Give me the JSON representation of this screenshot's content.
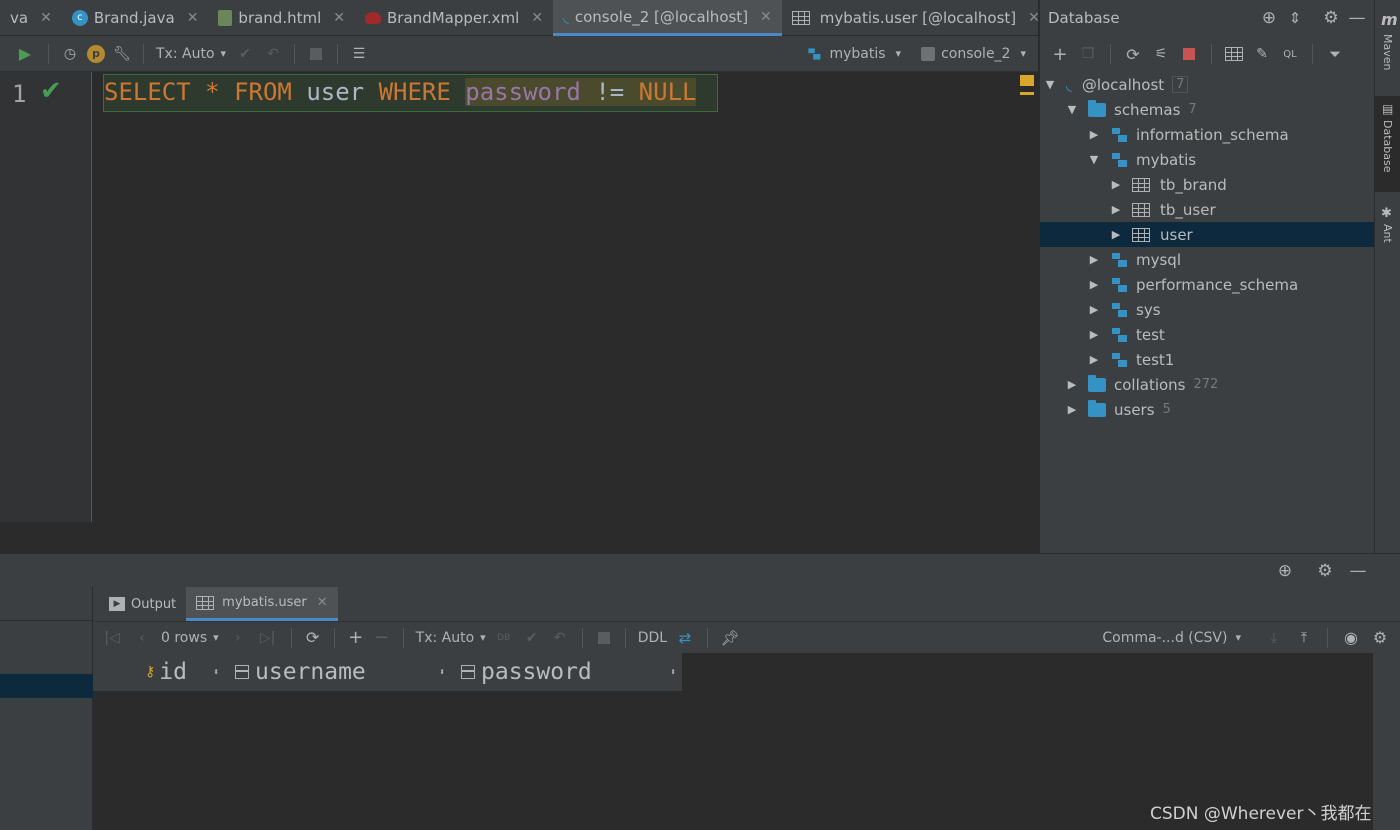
{
  "editor_tabs": [
    {
      "label": "va",
      "icon": "java-file-icon",
      "active": false
    },
    {
      "label": "Brand.java",
      "icon": "class-icon",
      "active": false
    },
    {
      "label": "brand.html",
      "icon": "html-icon",
      "active": false
    },
    {
      "label": "BrandMapper.xml",
      "icon": "xml-icon",
      "active": false
    },
    {
      "label": "console_2 [@localhost]",
      "icon": "console-icon",
      "active": true
    },
    {
      "label": "mybatis.user [@localhost]",
      "icon": "table-icon",
      "active": false
    }
  ],
  "editor_toolbar": {
    "tx_label": "Tx: Auto",
    "schema": "mybatis",
    "console": "console_2"
  },
  "editor": {
    "line_number": "1",
    "sql": {
      "kw_select": "SELECT",
      "star": "*",
      "kw_from": "FROM",
      "table": "user",
      "kw_where": "WHERE",
      "column": "password",
      "op": "!=",
      "kw_null": "NULL"
    }
  },
  "db_panel": {
    "title": "Database",
    "tree": [
      {
        "label": "@localhost",
        "count": "7",
        "level": 0,
        "expanded": true,
        "kind": "host"
      },
      {
        "label": "schemas",
        "count": "7",
        "level": 1,
        "expanded": true,
        "kind": "folder"
      },
      {
        "label": "information_schema",
        "count": "",
        "level": 2,
        "expanded": false,
        "kind": "schema"
      },
      {
        "label": "mybatis",
        "count": "",
        "level": 2,
        "expanded": true,
        "kind": "schema"
      },
      {
        "label": "tb_brand",
        "count": "",
        "level": 3,
        "expanded": false,
        "kind": "table"
      },
      {
        "label": "tb_user",
        "count": "",
        "level": 3,
        "expanded": false,
        "kind": "table"
      },
      {
        "label": "user",
        "count": "",
        "level": 3,
        "expanded": false,
        "kind": "table",
        "selected": true
      },
      {
        "label": "mysql",
        "count": "",
        "level": 2,
        "expanded": false,
        "kind": "schema"
      },
      {
        "label": "performance_schema",
        "count": "",
        "level": 2,
        "expanded": false,
        "kind": "schema"
      },
      {
        "label": "sys",
        "count": "",
        "level": 2,
        "expanded": false,
        "kind": "schema"
      },
      {
        "label": "test",
        "count": "",
        "level": 2,
        "expanded": false,
        "kind": "schema"
      },
      {
        "label": "test1",
        "count": "",
        "level": 2,
        "expanded": false,
        "kind": "schema"
      },
      {
        "label": "collations",
        "count": "272",
        "level": 1,
        "expanded": false,
        "kind": "folder"
      },
      {
        "label": "users",
        "count": "5",
        "level": 1,
        "expanded": false,
        "kind": "folder"
      }
    ]
  },
  "right_strip": {
    "maven": "Maven",
    "database": "Database",
    "ant": "Ant"
  },
  "results": {
    "tabs": [
      {
        "label": "Output",
        "active": false
      },
      {
        "label": "mybatis.user",
        "active": true
      }
    ],
    "rows_label": "0 rows",
    "tx_label": "Tx: Auto",
    "ddl_label": "DDL",
    "export_format": "Comma-...d (CSV)",
    "columns": [
      "id",
      "username",
      "password"
    ]
  },
  "watermark": "CSDN @Wherever丶我都在",
  "colors": {
    "keyword": "#cc7832",
    "identifier": "#a9b7c6",
    "column": "#9876aa",
    "accent": "#4a88c7",
    "run_green": "#499c54"
  }
}
